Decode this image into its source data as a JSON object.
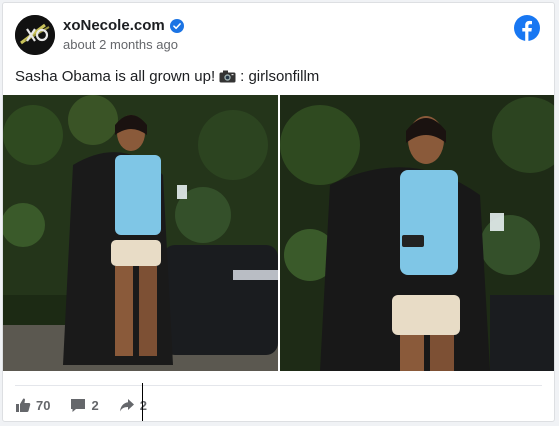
{
  "post": {
    "page_name": "xoNecole.com",
    "timestamp": "about 2 months ago",
    "text": "Sasha Obama is all grown up!",
    "credit": ": girlsonfillm",
    "icons": {
      "verified": "verified-badge-icon",
      "platform": "facebook-icon",
      "camera": "camera-icon"
    }
  },
  "actions": {
    "likes": "70",
    "comments": "2",
    "shares": "2"
  },
  "colors": {
    "facebook_blue": "#1877f2",
    "verified_blue": "#1b74e4",
    "text_muted": "#65676b"
  }
}
